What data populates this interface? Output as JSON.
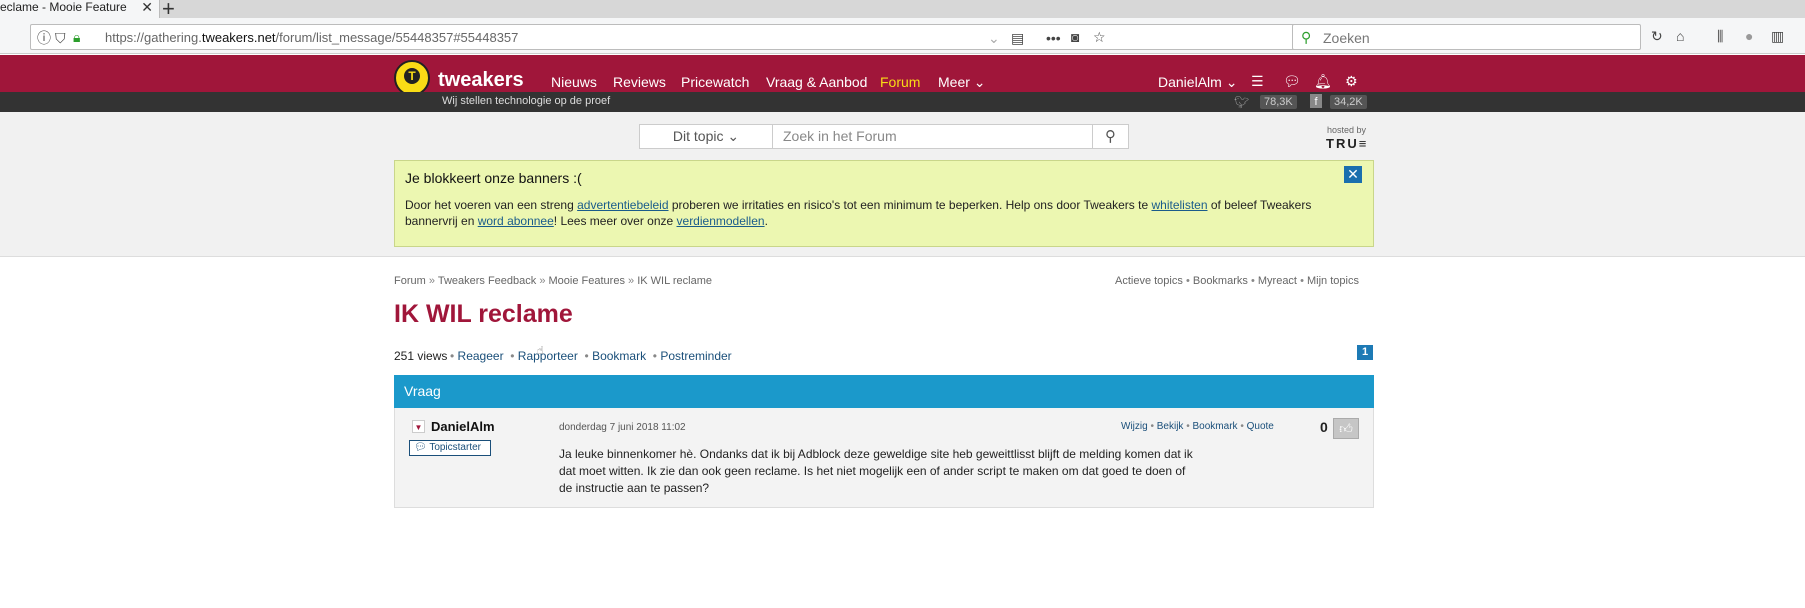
{
  "browser": {
    "tab_title": "eclame - Mooie Feature",
    "url_prefix": "https://gathering.",
    "url_domain": "tweakers.net",
    "url_path": "/forum/list_message/55448357#55448357",
    "search_placeholder": "Zoeken"
  },
  "site": {
    "brand": "tweakers",
    "nav": [
      "Nieuws",
      "Reviews",
      "Pricewatch",
      "Vraag & Aanbod",
      "Forum",
      "Meer"
    ],
    "active_nav": "Forum",
    "user": "DanielAlm",
    "tagline": "Wij stellen technologie op de proef",
    "twitter_count": "78,3K",
    "facebook_count": "34,2K",
    "accent_color": "#a0163a"
  },
  "forum_search": {
    "scope": "Dit topic",
    "placeholder": "Zoek in het Forum",
    "hosted_by": "hosted by",
    "host": "TRU≡"
  },
  "adblock_banner": {
    "heading": "Je blokkeert onze banners :(",
    "text1": "Door het voeren van een streng ",
    "link1": "advertentiebeleid",
    "text2": " proberen we irritaties en risico's tot een minimum te beperken. Help ons door Tweakers te ",
    "link2": "whitelisten",
    "text3": " of beleef Tweakers bannervrij en ",
    "link3": "word abonnee",
    "text4": "! Lees meer over onze ",
    "link4": "verdienmodellen",
    "text5": "."
  },
  "breadcrumb": [
    "Forum",
    "Tweakers Feedback",
    "Mooie Features",
    "IK WIL reclame"
  ],
  "quick_links": [
    "Actieve topics",
    "Bookmarks",
    "Myreact",
    "Mijn topics"
  ],
  "topic": {
    "title": "IK WIL reclame",
    "views": "251 views",
    "actions": [
      "Reageer",
      "Rapporteer",
      "Bookmark",
      "Postreminder"
    ],
    "page": "1",
    "section_label": "Vraag"
  },
  "post": {
    "author": "DanielAlm",
    "badge": "Topicstarter",
    "date": "donderdag 7 juni 2018 11:02",
    "actions": [
      "Wijzig",
      "Bekijk",
      "Bookmark",
      "Quote"
    ],
    "score": "0",
    "body": "Ja leuke binnenkomer hè. Ondanks dat ik bij Adblock deze geweldige site heb geweittlisst blijft de melding komen dat ik dat moet witten. Ik zie dan ook geen reclame. Is het niet mogelijk een of ander script te maken om dat goed te doen of de instructie aan te passen?"
  }
}
